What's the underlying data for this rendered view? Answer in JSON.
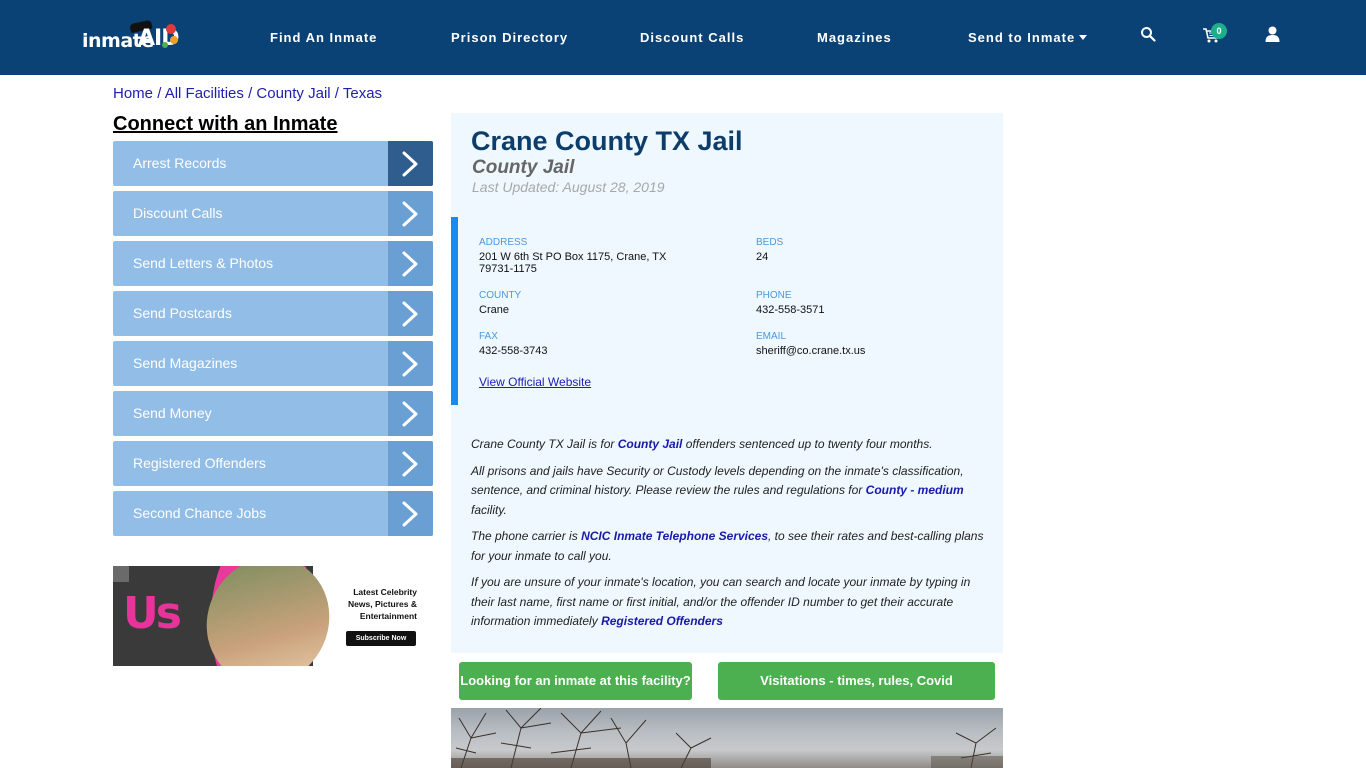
{
  "brand": {
    "logo_text_1": "inmate",
    "logo_text_2": "AID"
  },
  "nav": {
    "items": [
      {
        "label": "Find An Inmate"
      },
      {
        "label": "Prison Directory"
      },
      {
        "label": "Discount Calls"
      },
      {
        "label": "Magazines"
      },
      {
        "label": "Send to Inmate"
      }
    ],
    "cart_count": "0",
    "icons": [
      "search-icon",
      "cart-icon",
      "user-icon"
    ]
  },
  "breadcrumb": [
    {
      "label": "Home"
    },
    {
      "label": "All Facilities"
    },
    {
      "label": "County Jail"
    },
    {
      "label": "Texas"
    }
  ],
  "sidebar": {
    "title": "Connect with an Inmate",
    "items": [
      {
        "label": "Arrest Records"
      },
      {
        "label": "Discount Calls"
      },
      {
        "label": "Send Letters & Photos"
      },
      {
        "label": "Send Postcards"
      },
      {
        "label": "Send Magazines"
      },
      {
        "label": "Send Money"
      },
      {
        "label": "Registered Offenders"
      },
      {
        "label": "Second Chance Jobs"
      }
    ],
    "ad": {
      "brand": "Us",
      "copy_line1": "Latest Celebrity",
      "copy_line2": "News, Pictures &",
      "copy_line3": "Entertainment",
      "cta": "Subscribe Now"
    }
  },
  "facility": {
    "name": "Crane County TX Jail",
    "type": "County Jail",
    "last_updated": "Last Updated: August 28, 2019",
    "fields": {
      "address_label": "ADDRESS",
      "address_line1": "201 W 6th St PO Box 1175, Crane, TX",
      "address_line2": "79731-1175",
      "beds_label": "BEDS",
      "beds": "24",
      "county_label": "COUNTY",
      "county": "Crane",
      "phone_label": "PHONE",
      "phone": "432-558-3571",
      "fax_label": "FAX",
      "fax": "432-558-3743",
      "email_label": "EMAIL",
      "email": "sheriff@co.crane.tx.us"
    },
    "website_link": "View Official Website"
  },
  "description": {
    "p1_a": "Crane County TX Jail is for ",
    "p1_link": "County Jail",
    "p1_b": " offenders sentenced up to twenty four months.",
    "p2_a": "All prisons and jails have Security or Custody levels depending on the inmate's classification, sentence, and criminal history. Please review the rules and regulations for ",
    "p2_link": "County - medium",
    "p2_b": " facility.",
    "p3_a": "The phone carrier is ",
    "p3_link": "NCIC Inmate Telephone Services",
    "p3_b": ", to see their rates and best-calling plans for your inmate to call you.",
    "p4_a": "If you are unsure of your inmate's location, you can search and locate your inmate by typing in their last name, first name or first initial, and/or the offender ID number to get their accurate information immediately ",
    "p4_link": "Registered Offenders"
  },
  "buttons": {
    "looking": "Looking for an inmate at this facility?",
    "visitations": "Visitations - times, rules, Covid cancellations"
  },
  "colors": {
    "navbar": "#0a4275",
    "sidebar_item": "#92bde6",
    "sidebar_arrow": "#6a9fd3",
    "sidebar_arrow_active": "#2f5d8d",
    "card_bg": "#eef8fe",
    "accent_bar": "#1a8bea",
    "green_button": "#4caf50",
    "title": "#0d3e6b"
  }
}
